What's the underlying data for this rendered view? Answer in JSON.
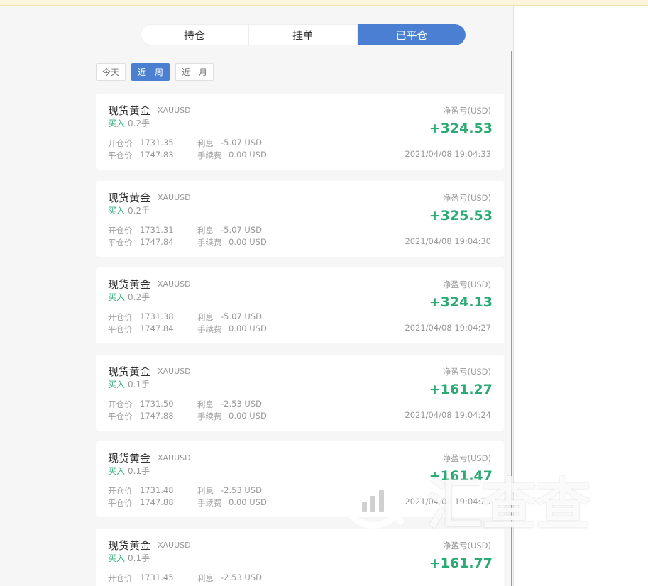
{
  "tabs": [
    {
      "label": "持仓",
      "active": false
    },
    {
      "label": "挂单",
      "active": false
    },
    {
      "label": "已平仓",
      "active": true
    }
  ],
  "range_filters": [
    {
      "label": "今天",
      "active": false
    },
    {
      "label": "近一周",
      "active": true
    },
    {
      "label": "近一月",
      "active": false
    }
  ],
  "labels": {
    "open_price": "开仓价",
    "close_price": "平仓价",
    "interest": "利息",
    "fee": "手续费",
    "net_pnl": "净盈亏(USD)"
  },
  "trades": [
    {
      "name": "现货黄金",
      "symbol": "XAUUSD",
      "direction": "买入",
      "lots": "0.2手",
      "open": "1731.35",
      "close": "1747.83",
      "interest": "-5.07 USD",
      "fee": "0.00 USD",
      "pnl": "+324.53",
      "time": "2021/04/08 19:04:33"
    },
    {
      "name": "现货黄金",
      "symbol": "XAUUSD",
      "direction": "买入",
      "lots": "0.2手",
      "open": "1731.31",
      "close": "1747.84",
      "interest": "-5.07 USD",
      "fee": "0.00 USD",
      "pnl": "+325.53",
      "time": "2021/04/08 19:04:30"
    },
    {
      "name": "现货黄金",
      "symbol": "XAUUSD",
      "direction": "买入",
      "lots": "0.2手",
      "open": "1731.38",
      "close": "1747.84",
      "interest": "-5.07 USD",
      "fee": "0.00 USD",
      "pnl": "+324.13",
      "time": "2021/04/08 19:04:27"
    },
    {
      "name": "现货黄金",
      "symbol": "XAUUSD",
      "direction": "买入",
      "lots": "0.1手",
      "open": "1731.50",
      "close": "1747.88",
      "interest": "-2.53 USD",
      "fee": "0.00 USD",
      "pnl": "+161.27",
      "time": "2021/04/08 19:04:24"
    },
    {
      "name": "现货黄金",
      "symbol": "XAUUSD",
      "direction": "买入",
      "lots": "0.1手",
      "open": "1731.48",
      "close": "1747.88",
      "interest": "-2.53 USD",
      "fee": "0.00 USD",
      "pnl": "+161.47",
      "time": "2021/04/08 19:04:20"
    },
    {
      "name": "现货黄金",
      "symbol": "XAUUSD",
      "direction": "买入",
      "lots": "0.1手",
      "open": "1731.45",
      "close": "",
      "interest": "-2.53 USD",
      "fee": "",
      "pnl": "+161.77",
      "time": ""
    }
  ],
  "watermark": {
    "text": "汇查查",
    "icon": "magnifier-chart-icon"
  },
  "colors": {
    "accent": "#4a7fd1",
    "profit": "#2bab74",
    "buy": "#2fb37b"
  }
}
